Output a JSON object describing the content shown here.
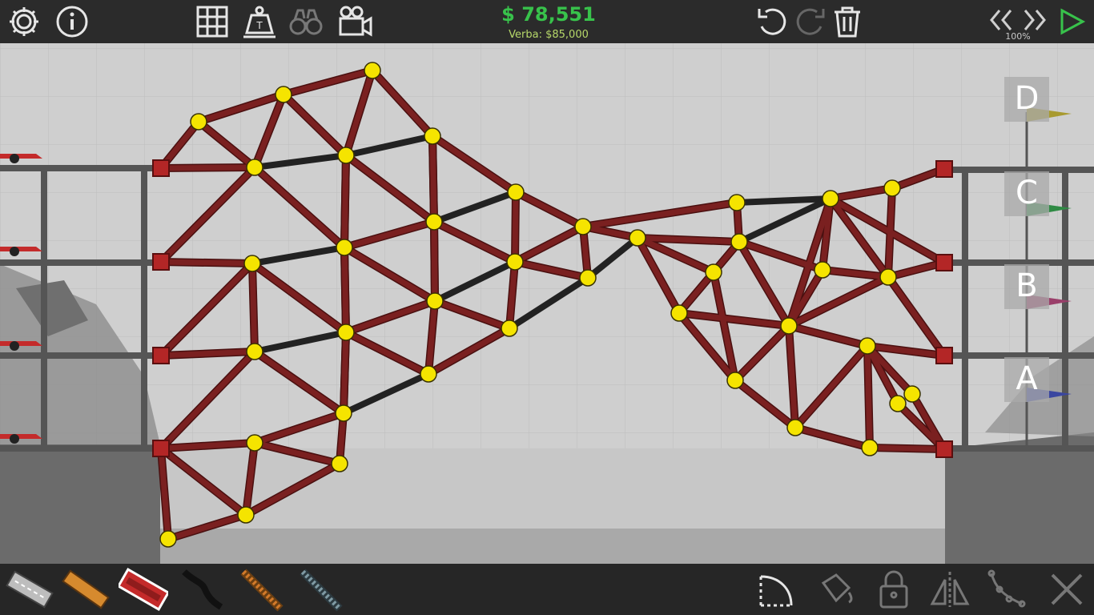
{
  "hud": {
    "money": "$ 78,551",
    "budget": "Verba: $85,000",
    "speed": "100%"
  },
  "toolbar_top": {
    "left": [
      "gear-icon",
      "info-icon",
      "grid-icon",
      "weight-icon",
      "binoculars-icon",
      "video-camera-icon"
    ],
    "right": [
      "undo-icon",
      "redo-icon",
      "trash-icon",
      "rewind-icon",
      "fast-forward-icon",
      "play-icon"
    ]
  },
  "checkpoints": [
    "D",
    "C",
    "B",
    "A"
  ],
  "colors": {
    "road": "#7a2020",
    "beam": "#222222",
    "joint": "#f5e400",
    "anchor": "#b32626",
    "money": "#38c24b"
  },
  "materials": [
    "road",
    "wood",
    "steel",
    "rope",
    "reinforced-road",
    "cable"
  ],
  "selected_material": "steel",
  "tools_bottom": [
    "arc-icon",
    "paint-icon",
    "lock-icon",
    "mirror-icon",
    "split-icon",
    "delete-icon"
  ]
}
